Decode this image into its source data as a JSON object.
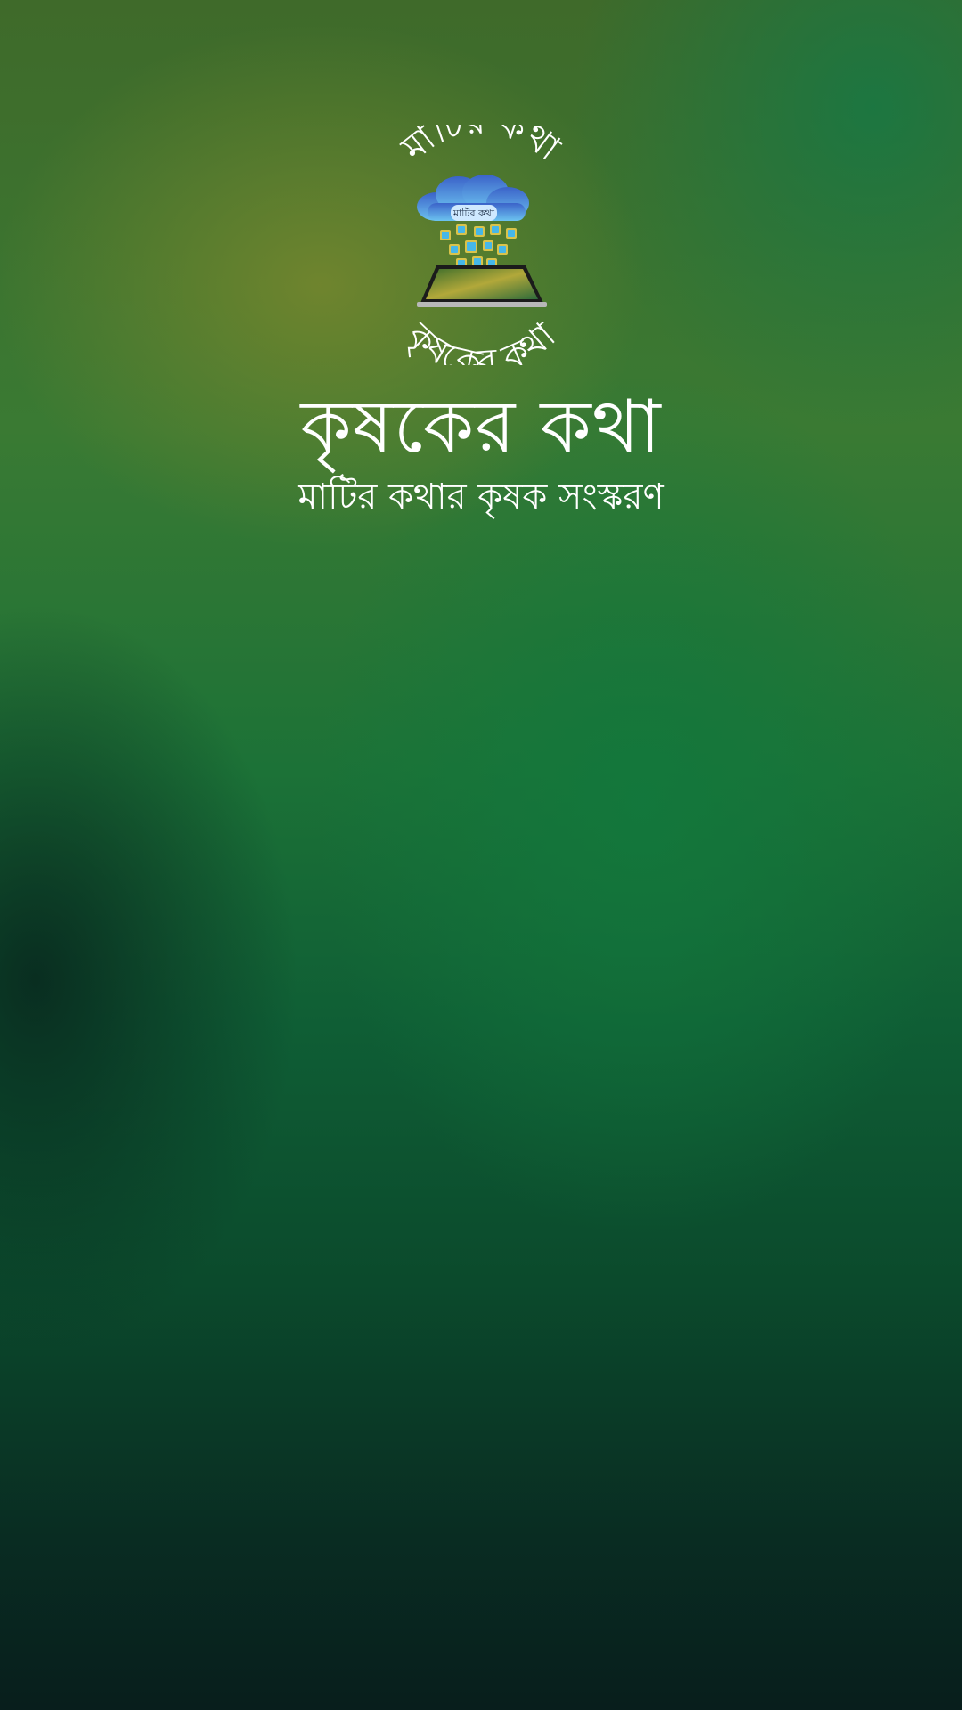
{
  "logo": {
    "ring_top_text": "মাটির কথা",
    "ring_bottom_text": "কৃষকের কথা",
    "cloud_label": "মাটির কথা",
    "icon_name": "cloud-tablet-logo-icon"
  },
  "app": {
    "title": "কৃষকের কথা",
    "subtitle": "মাটির কথার কৃষক সংস্করণ"
  },
  "colors": {
    "text": "#ffffff",
    "background_top": "#3f6a2a",
    "background_mid": "#1c7237",
    "background_bottom": "#081e1c"
  }
}
